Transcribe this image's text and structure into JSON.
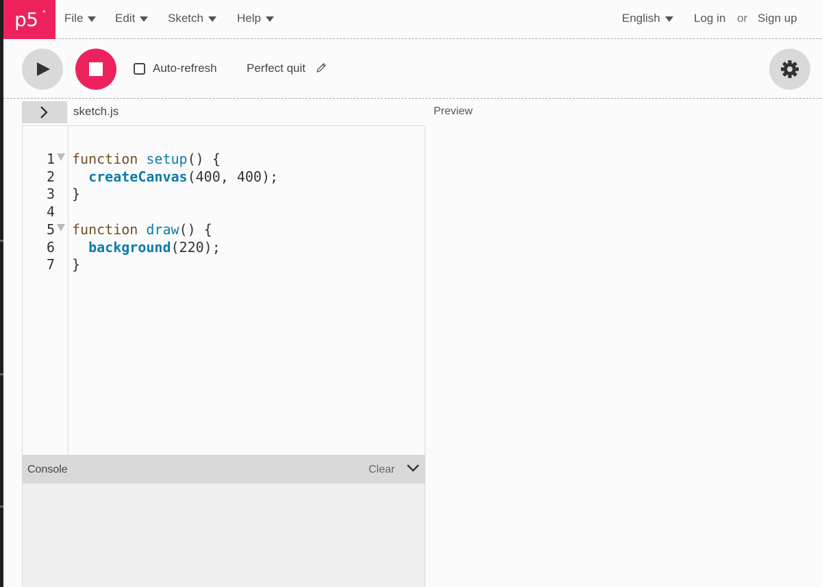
{
  "nav": {
    "logo": "p5",
    "logo_star": "*",
    "menus": {
      "file": "File",
      "edit": "Edit",
      "sketch": "Sketch",
      "help": "Help"
    },
    "language": "English",
    "login": "Log in",
    "or": "or",
    "signup": "Sign up"
  },
  "toolbar": {
    "auto_refresh_label": "Auto-refresh",
    "auto_refresh_checked": false,
    "sketch_name": "Perfect quit"
  },
  "editor": {
    "file_name": "sketch.js",
    "preview_label": "Preview",
    "line_numbers": [
      "1",
      "2",
      "3",
      "4",
      "5",
      "6",
      "7"
    ],
    "code": {
      "l1_kw": "function",
      "l1_fn": "setup",
      "l1_rest": "() {",
      "l2_indent": "  ",
      "l2_fn": "createCanvas",
      "l2_rest": "(400, 400);",
      "l3": "}",
      "l5_kw": "function",
      "l5_fn": "draw",
      "l5_rest": "() {",
      "l6_indent": "  ",
      "l6_fn": "background",
      "l6_rest": "(220);",
      "l7": "}"
    }
  },
  "console": {
    "title": "Console",
    "clear": "Clear"
  },
  "colors": {
    "accent": "#ed225d",
    "keyword": "#704f21",
    "function": "#0b7ca9"
  }
}
